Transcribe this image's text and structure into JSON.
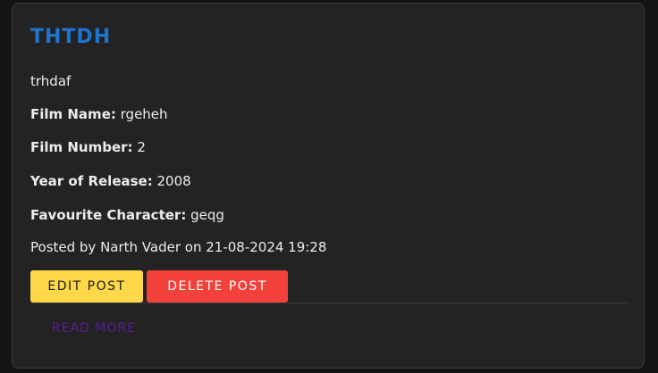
{
  "post": {
    "title": "THTDH",
    "body": "trhdaf",
    "film_name_label": "Film Name:",
    "film_name": "rgeheh",
    "film_number_label": "Film Number:",
    "film_number": "2",
    "year_label": "Year of Release:",
    "year": "2008",
    "character_label": "Favourite Character:",
    "character": "geqg",
    "posted_by": "Posted by Narth Vader on 21-08-2024 19:28"
  },
  "actions": {
    "edit_label": "EDIT POST",
    "delete_label": "DELETE POST",
    "read_more_label": "READ MORE"
  },
  "colors": {
    "title": "#1e74d0",
    "edit_button": "#ffd84a",
    "delete_button": "#f2413a",
    "read_more": "#5a1c95",
    "card_background": "#232323"
  }
}
